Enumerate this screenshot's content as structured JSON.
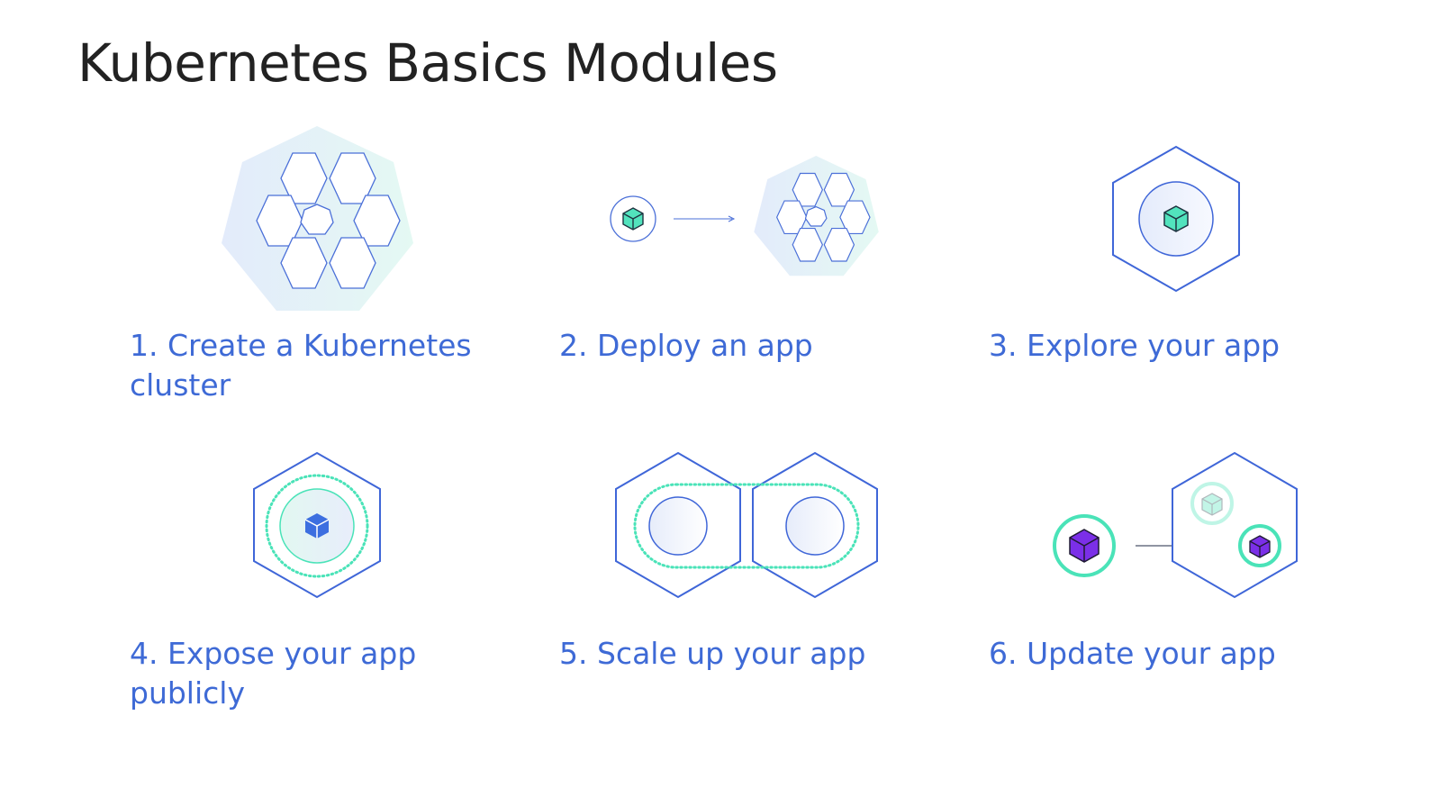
{
  "page": {
    "title": "Kubernetes Basics Modules"
  },
  "colors": {
    "accent": "#3e6ad6",
    "outline": "#4a6fd8",
    "teal": "#4ae3b8",
    "purple": "#7b2fe8"
  },
  "modules": [
    {
      "label": "1. Create a Kubernetes cluster",
      "icon": "cluster-icon"
    },
    {
      "label": "2. Deploy an app",
      "icon": "deploy-icon"
    },
    {
      "label": "3. Explore your app",
      "icon": "explore-icon"
    },
    {
      "label": "4. Expose your app publicly",
      "icon": "expose-icon"
    },
    {
      "label": "5. Scale up your app",
      "icon": "scale-icon"
    },
    {
      "label": "6. Update your app",
      "icon": "update-icon"
    }
  ]
}
